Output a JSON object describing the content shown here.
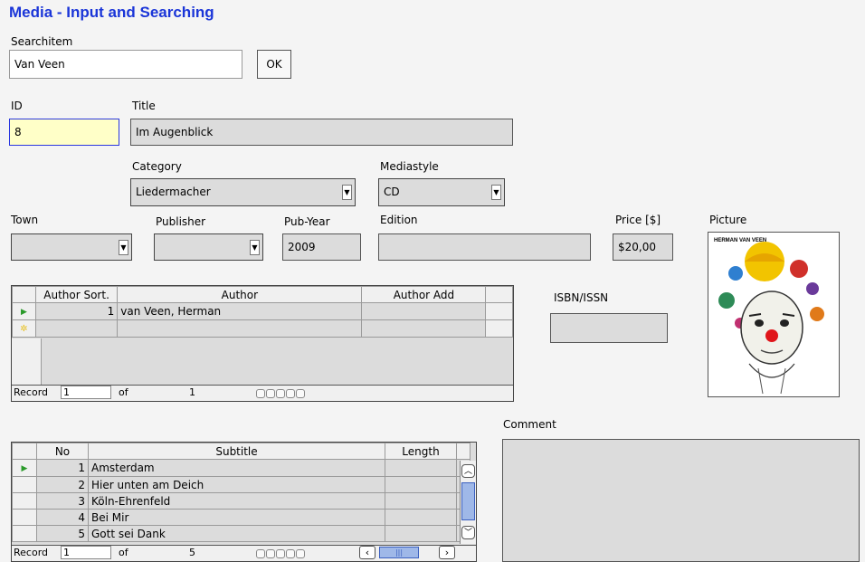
{
  "window": {
    "title": "Media - Input and Searching"
  },
  "search": {
    "label": "Searchitem",
    "value": "Van Veen",
    "ok_label": "OK"
  },
  "id": {
    "label": "ID",
    "value": "8"
  },
  "titlefield": {
    "label": "Title",
    "value": "Im Augenblick"
  },
  "category": {
    "label": "Category",
    "value": "Liedermacher"
  },
  "mediastyle": {
    "label": "Mediastyle",
    "value": "CD"
  },
  "town": {
    "label": "Town",
    "value": ""
  },
  "publisher": {
    "label": "Publisher",
    "value": ""
  },
  "pubyear": {
    "label": "Pub-Year",
    "value": "2009"
  },
  "edition": {
    "label": "Edition",
    "value": ""
  },
  "price": {
    "label": "Price [$]",
    "value": "$20,00"
  },
  "picture": {
    "label": "Picture",
    "album_text": "HERMAN VAN VEEN"
  },
  "isbn": {
    "label": "ISBN/ISSN",
    "value": ""
  },
  "comment": {
    "label": "Comment",
    "value": ""
  },
  "author_grid": {
    "headers": [
      "Author Sort.",
      "Author",
      "Author Add"
    ],
    "rows": [
      {
        "sort": "1",
        "author": "van Veen, Herman",
        "add": ""
      }
    ],
    "nav": {
      "record_label": "Record",
      "record_value": "1",
      "of_label": "of",
      "total": "1"
    }
  },
  "subtitle_grid": {
    "headers": [
      "No",
      "Subtitle",
      "Length"
    ],
    "rows": [
      {
        "no": "1",
        "subtitle": "Amsterdam",
        "length": ""
      },
      {
        "no": "2",
        "subtitle": "Hier unten am Deich",
        "length": ""
      },
      {
        "no": "3",
        "subtitle": "Köln-Ehrenfeld",
        "length": ""
      },
      {
        "no": "4",
        "subtitle": "Bei Mir",
        "length": ""
      },
      {
        "no": "5",
        "subtitle": "Gott sei Dank",
        "length": ""
      }
    ],
    "nav": {
      "record_label": "Record",
      "record_value": "1",
      "of_label": "of",
      "total": "5"
    }
  },
  "colors": {
    "title": "#1a35d8",
    "field_bg": "#dcdcdc",
    "id_bg": "#ffffc8",
    "record_pointer": "#2a9a2a",
    "new_record": "#e8c020"
  },
  "icons": {
    "current_record": "triangle-right-icon",
    "new_record": "star-icon",
    "dropdown": "chevron-down-icon"
  }
}
